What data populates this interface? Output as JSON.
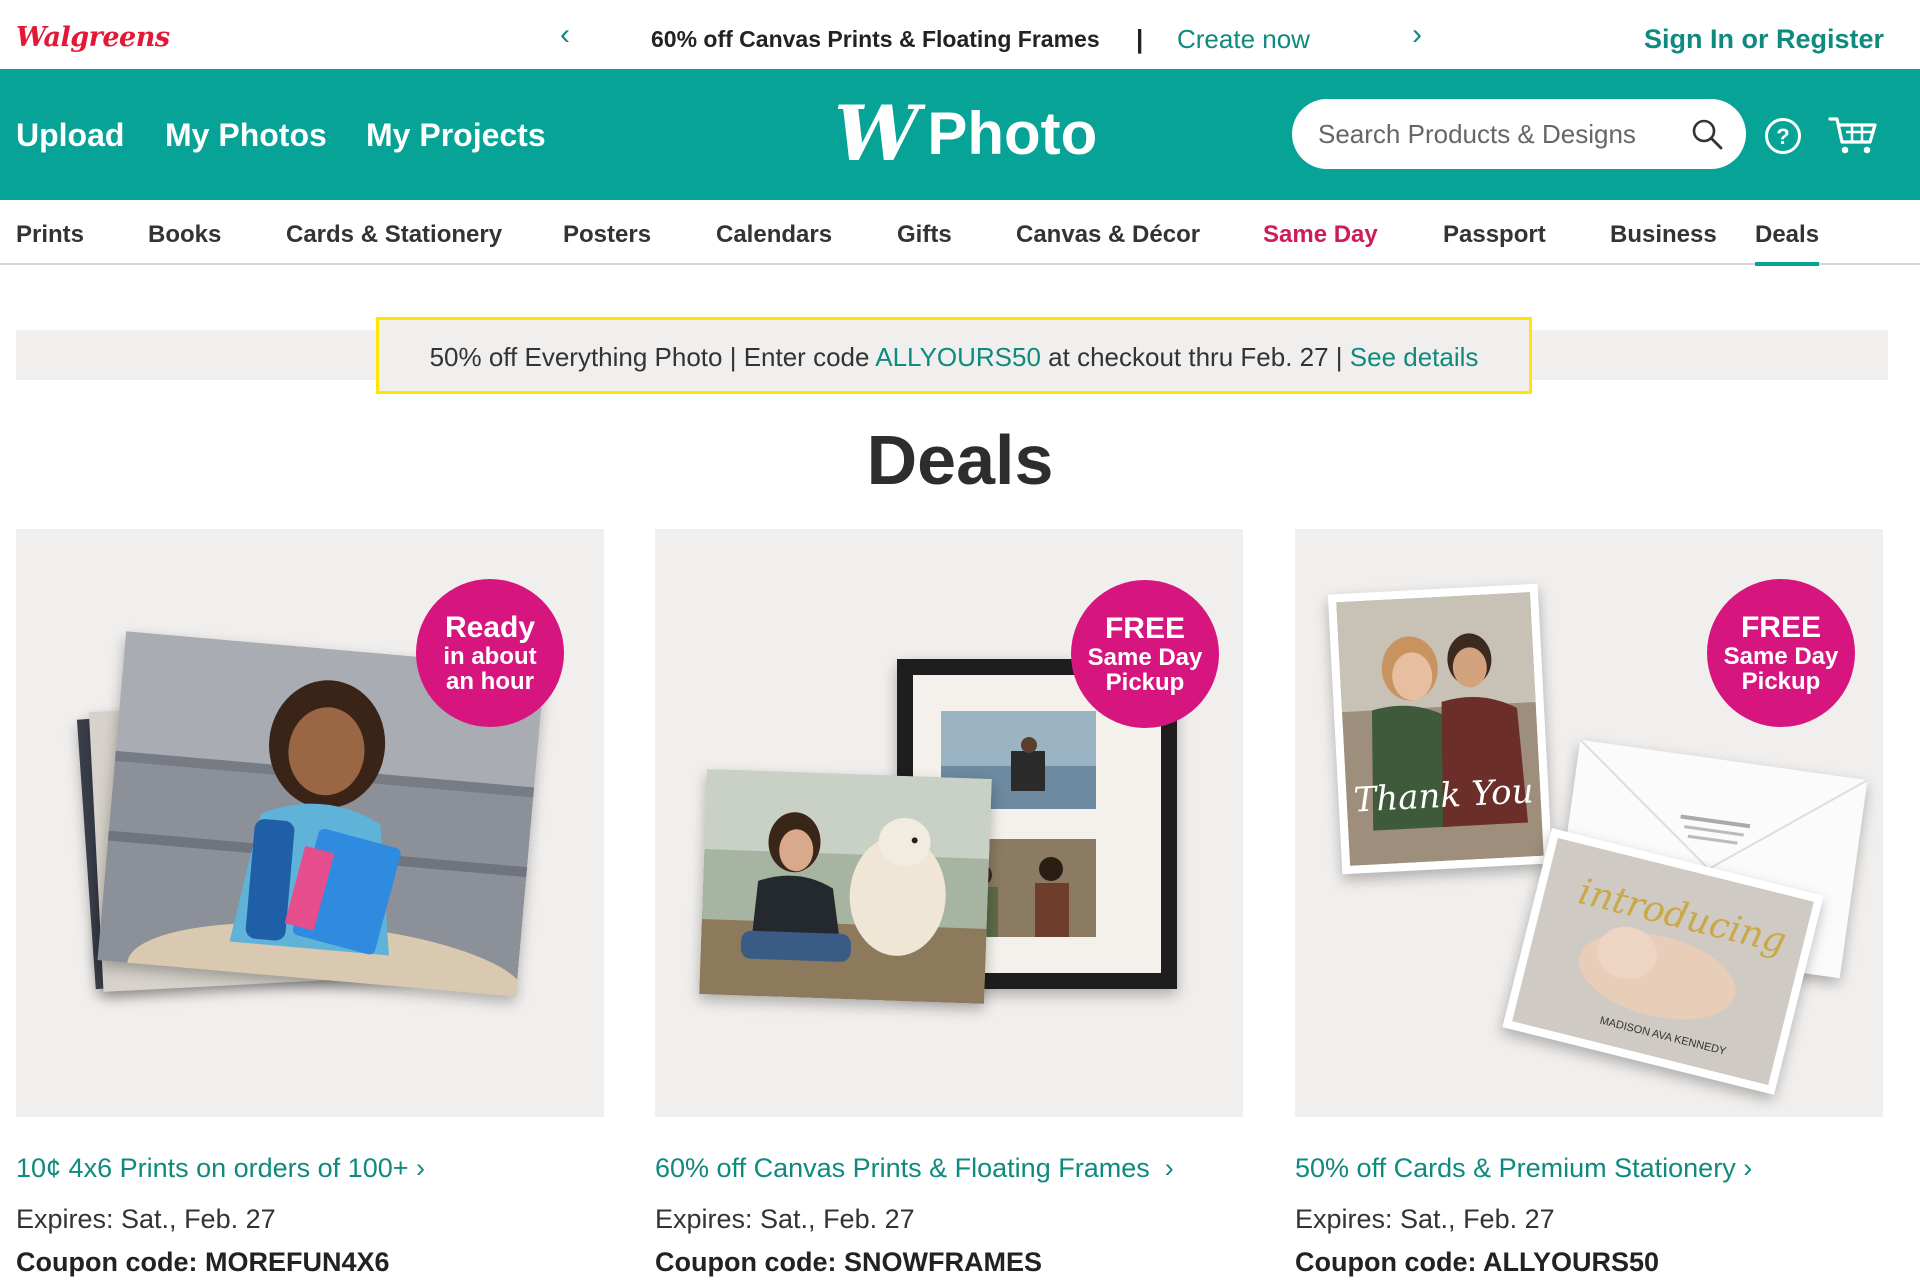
{
  "topbar": {
    "logo_text": "Walgreens",
    "promo_prev_icon": "chevron-left-icon",
    "promo_text": "60% off Canvas Prints & Floating Frames",
    "promo_separator": "|",
    "promo_cta": "Create now",
    "promo_next_icon": "chevron-right-icon",
    "signin": "Sign In or Register"
  },
  "header": {
    "links": [
      "Upload",
      "My Photos",
      "My Projects"
    ],
    "logo_mark": "W",
    "logo_word": "Photo",
    "search_placeholder": "Search Products & Designs",
    "icons": [
      "search-icon",
      "help-icon",
      "cart-icon"
    ],
    "brand_color": "#06a396"
  },
  "nav": {
    "items": [
      "Prints",
      "Books",
      "Cards & Stationery",
      "Posters",
      "Calendars",
      "Gifts",
      "Canvas & Décor",
      "Same Day",
      "Passport",
      "Business",
      "Deals"
    ],
    "active": "Deals",
    "highlight": "Same Day",
    "highlight_color": "#cf1b5c"
  },
  "banner": {
    "prefix": "50% off Everything Photo | Enter code ",
    "code": "ALLYOURS50",
    "suffix": " at checkout thru Feb. 27 | ",
    "link": "See details"
  },
  "page_title": "Deals",
  "cards": [
    {
      "badge": [
        "Ready",
        "in about",
        "an hour"
      ],
      "title": "10¢ 4x6 Prints on orders of 100+",
      "arrow": "›",
      "expires": "Expires: Sat., Feb. 27",
      "coupon": "Coupon code: MOREFUN4X6"
    },
    {
      "badge": [
        "FREE",
        "Same Day",
        "Pickup"
      ],
      "title": "60% off Canvas Prints & Floating Frames",
      "arrow": "›",
      "expires": "Expires: Sat., Feb. 27",
      "coupon": "Coupon code: SNOWFRAMES"
    },
    {
      "badge": [
        "FREE",
        "Same Day",
        "Pickup"
      ],
      "title": "50% off Cards & Premium Stationery",
      "arrow": "›",
      "expires": "Expires: Sat., Feb. 27",
      "coupon": "Coupon code: ALLYOURS50",
      "card_script": "Thank You",
      "card2_script": "introducing",
      "card2_caption": "MADISON AVA KENNEDY"
    }
  ]
}
